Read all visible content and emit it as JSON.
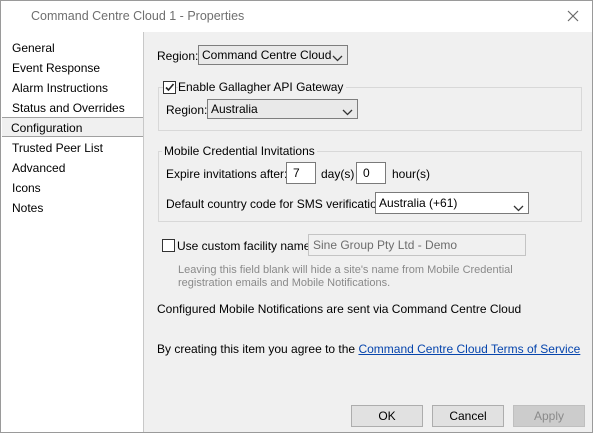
{
  "window": {
    "title": "Command Centre Cloud 1 - Properties"
  },
  "nav": {
    "items": [
      {
        "label": "General"
      },
      {
        "label": "Event Response"
      },
      {
        "label": "Alarm Instructions"
      },
      {
        "label": "Status and Overrides"
      },
      {
        "label": "Configuration"
      },
      {
        "label": "Trusted Peer List"
      },
      {
        "label": "Advanced"
      },
      {
        "label": "Icons"
      },
      {
        "label": "Notes"
      }
    ],
    "active": "Configuration"
  },
  "config": {
    "region_label": "Region:",
    "region_value": "Command Centre Cloud",
    "gateway_checkbox_label": "Enable Gallagher API Gateway",
    "gateway_checked": true,
    "gateway_region_label": "Region:",
    "gateway_region_value": "Australia",
    "mci_group_title": "Mobile Credential Invitations",
    "expire_label": "Expire invitations after:",
    "expire_days": "7",
    "days_unit": "day(s)",
    "expire_hours": "0",
    "hours_unit": "hour(s)",
    "country_label": "Default country code for SMS verification:",
    "country_value": "Australia (+61)",
    "facility_checkbox_label": "Use custom facility name",
    "facility_checked": false,
    "facility_name": "Sine Group Pty Ltd - Demo",
    "facility_hint_line1": "Leaving this field blank will hide a site's name from Mobile Credential",
    "facility_hint_line2": "registration emails and Mobile Notifications.",
    "notifications_text": "Configured Mobile Notifications are sent via Command Centre Cloud",
    "agree_prefix": "By creating this item you agree to the ",
    "terms_link": "Command Centre Cloud Terms of Service"
  },
  "buttons": {
    "ok": "OK",
    "cancel": "Cancel",
    "apply": "Apply"
  },
  "colors": {
    "link": "#0645ad",
    "background": "#f0f0f0"
  }
}
